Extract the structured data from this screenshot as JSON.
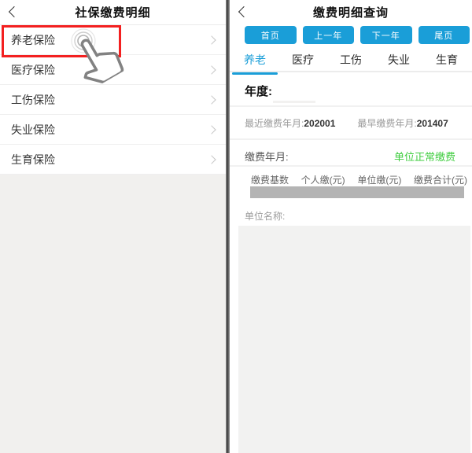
{
  "left_screen": {
    "header": {
      "title": "社保缴费明细",
      "back_icon": "chevron-left"
    },
    "list": [
      {
        "label": "养老保险",
        "highlighted": true
      },
      {
        "label": "医疗保险",
        "highlighted": false
      },
      {
        "label": "工伤保险",
        "highlighted": false
      },
      {
        "label": "失业保险",
        "highlighted": false
      },
      {
        "label": "生育保险",
        "highlighted": false
      }
    ],
    "row_chevron_icon": "chevron-right",
    "gesture_icon": "tap-hand-with-ripple"
  },
  "right_screen": {
    "header": {
      "title": "缴费明细查询",
      "back_icon": "chevron-left"
    },
    "pager_buttons": [
      "首页",
      "上一年",
      "下一年",
      "尾页"
    ],
    "tabs": [
      {
        "label": "养老",
        "active": true
      },
      {
        "label": "医疗",
        "active": false
      },
      {
        "label": "工伤",
        "active": false
      },
      {
        "label": "失业",
        "active": false
      },
      {
        "label": "生育",
        "active": false
      }
    ],
    "year_label": "年度:",
    "recent_label": "最近缴费年月:",
    "recent_value": "202001",
    "earliest_label": "最早缴费年月:",
    "earliest_value": "201407",
    "pay_month_label": "缴费年月:",
    "pay_status": "单位正常缴费",
    "table_headers": [
      "缴费基数",
      "个人缴(元)",
      "单位缴(元)",
      "缴费合计(元)"
    ],
    "company_label": "单位名称:"
  },
  "colors": {
    "accent_blue": "#1a9ed8",
    "status_green": "#3fcd3f",
    "highlight_red": "#f32020",
    "redacted_bar_gray": "#b4b4b4"
  }
}
